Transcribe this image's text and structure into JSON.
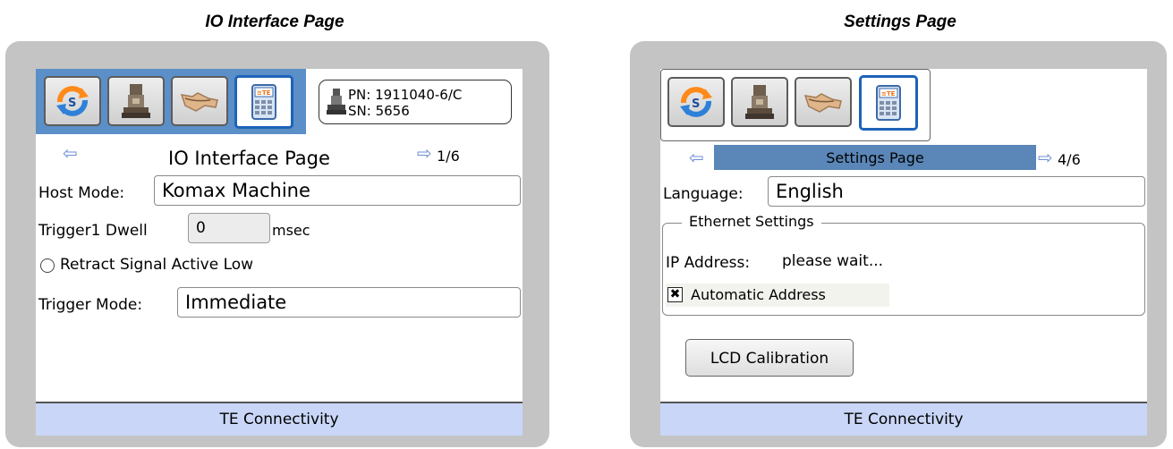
{
  "left_panel": {
    "caption": "IO Interface Page",
    "part_info": {
      "pn": "PN: 1911040-6/C",
      "sn": "SN: 5656"
    },
    "nav": {
      "back_icon": "arrow-left-icon",
      "title": "IO Interface Page",
      "forward_icon": "arrow-right-icon",
      "page": "1/6"
    },
    "host_mode": {
      "label": "Host Mode:",
      "value": "Komax Machine"
    },
    "trigger_dwell": {
      "label": "Trigger1 Dwell",
      "value": "0",
      "unit": "msec"
    },
    "retract_signal": {
      "label": "Retract Signal Active Low",
      "checked": false
    },
    "trigger_mode": {
      "label": "Trigger Mode:",
      "value": "Immediate"
    },
    "footer": "TE Connectivity"
  },
  "right_panel": {
    "caption": "Settings Page",
    "nav": {
      "back_icon": "arrow-left-icon",
      "title": "Settings Page",
      "forward_icon": "arrow-right-icon",
      "page": "4/6"
    },
    "language": {
      "label": "Language:",
      "value": "English"
    },
    "ethernet": {
      "group_label": "Ethernet Settings",
      "ip_label": "IP Address:",
      "ip_value": "please wait...",
      "automatic_label": "Automatic Address",
      "automatic_checked": true
    },
    "lcd_button": "LCD Calibration",
    "footer": "TE Connectivity"
  },
  "toolbar_icons": [
    "sync-icon",
    "applicator-machine-icon",
    "cable-wire-icon",
    "te-keypad-icon"
  ],
  "colors": {
    "accent": "#1d63b8",
    "toolbar_bg": "#5b8fc8",
    "title_bar": "#5a87b8",
    "footer_bg": "#c9d6f7",
    "frame": "#c4c4c4"
  }
}
